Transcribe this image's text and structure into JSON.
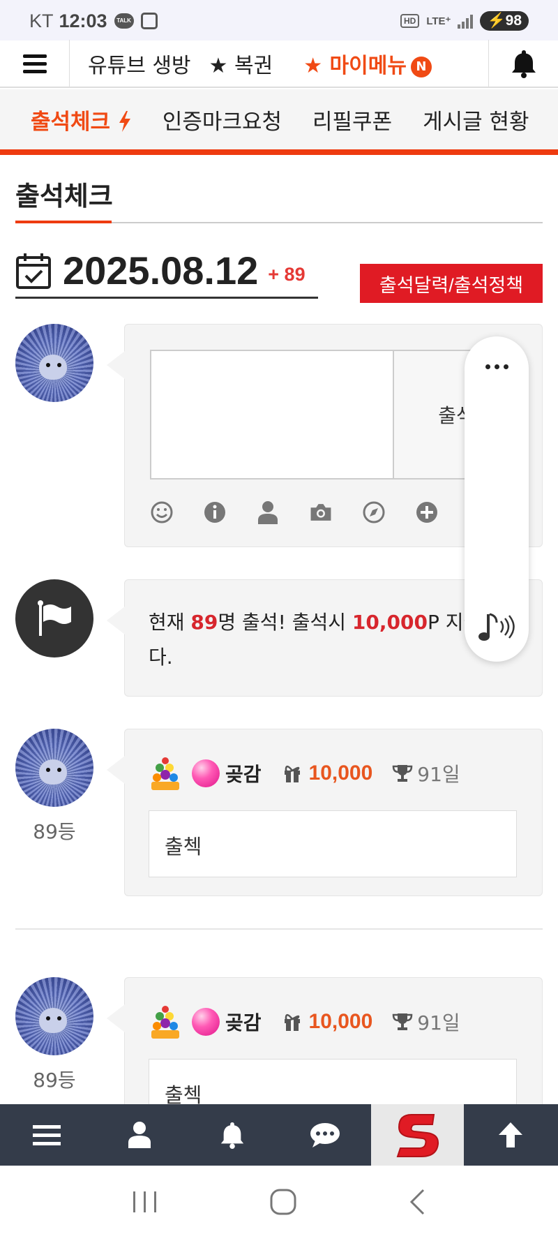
{
  "status_bar": {
    "carrier": "KT",
    "time": "12:03",
    "talk": "TALK",
    "hd": "HD",
    "network": "LTE⁺",
    "battery": "98"
  },
  "top_nav": {
    "items": [
      "유튜브 생방",
      "★ 복권"
    ],
    "my_menu": "★ 마이메뉴",
    "new_badge": "N"
  },
  "sub_tabs": [
    "출석체크",
    "인증마크요청",
    "리필쿠폰",
    "게시글 현황"
  ],
  "page": {
    "title": "출석체크",
    "date": "2025.08.12",
    "count_delta": "+ 89",
    "policy_button": "출석달력/출석정책"
  },
  "compose": {
    "submit_label": "출석"
  },
  "notice": {
    "pre": "현재 ",
    "count": "89",
    "mid": "명 출석! 출석시 ",
    "points": "10,000",
    "post": "P 지급됩니다."
  },
  "entries": [
    {
      "rank": "89등",
      "nick": "곶감",
      "points": "10,000",
      "days": "91일",
      "message": "출첵"
    },
    {
      "rank": "89등",
      "nick": "곶감",
      "points": "10,000",
      "days": "91일",
      "message": "출첵"
    }
  ],
  "colors": {
    "accent": "#f04a14",
    "red_button": "#e01b24",
    "bottom_bar": "#343c4a"
  }
}
